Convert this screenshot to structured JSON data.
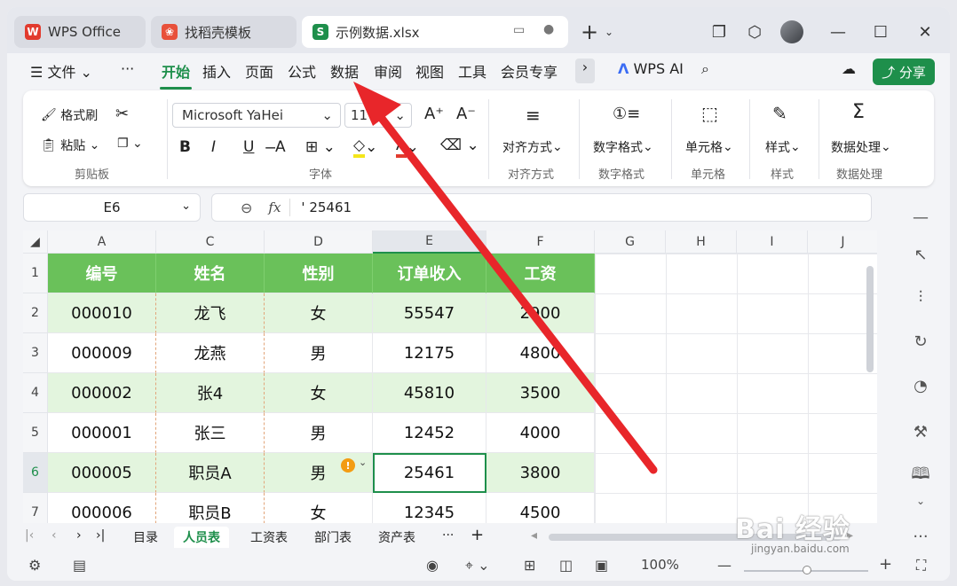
{
  "titlebar": {
    "tabs": [
      {
        "label": "WPS Office",
        "icon": "wps-logo-icon"
      },
      {
        "label": "找稻壳模板",
        "icon": "daoke-logo-icon"
      },
      {
        "label": "示例数据.xlsx",
        "icon": "sheet-logo-icon"
      }
    ],
    "new_tab": "+",
    "colors": {
      "accent": "#1e8f4b",
      "wps_red": "#e23b2e"
    }
  },
  "menubar": {
    "file_label": "文件",
    "items": [
      "开始",
      "插入",
      "页面",
      "公式",
      "数据",
      "审阅",
      "视图",
      "工具",
      "会员专享"
    ],
    "active": "开始",
    "wps_ai": "WPS AI",
    "share": "分享"
  },
  "ribbon": {
    "format_painter": "格式刷",
    "paste": "粘贴",
    "clipboard_group": "剪贴板",
    "font_name": "Microsoft YaHei",
    "font_size": "11",
    "font_group": "字体",
    "align_btn": "对齐方式",
    "align_group": "对齐方式",
    "number_btn": "数字格式",
    "number_group": "数字格式",
    "cell_btn": "单元格",
    "cell_group": "单元格",
    "style_btn": "样式",
    "style_group": "样式",
    "data_btn": "数据处理",
    "data_group": "数据处理"
  },
  "formula": {
    "name_box": "E6",
    "fx": "fx",
    "value": "' 25461"
  },
  "grid": {
    "columns": [
      "A",
      "C",
      "D",
      "E",
      "F",
      "G",
      "H",
      "I",
      "J"
    ],
    "rows": [
      "1",
      "2",
      "3",
      "4",
      "5",
      "6",
      "7"
    ],
    "header": [
      "编号",
      "姓名",
      "性别",
      "订单收入",
      "工资"
    ],
    "data": [
      [
        "000010",
        "龙飞",
        "女",
        "55547",
        "2900"
      ],
      [
        "000009",
        "龙燕",
        "男",
        "12175",
        "4800"
      ],
      [
        "000002",
        "张4",
        "女",
        "45810",
        "3500"
      ],
      [
        "000001",
        "张三",
        "男",
        "12452",
        "4000"
      ],
      [
        "000005",
        "职员A",
        "男",
        "25461",
        "3800"
      ],
      [
        "000006",
        "职员B",
        "女",
        "12345",
        "4500"
      ]
    ],
    "selected_cell": "E6"
  },
  "sheets": {
    "tabs": [
      "目录",
      "人员表",
      "工资表",
      "部门表",
      "资产表"
    ],
    "active": "人员表",
    "more": "···",
    "add": "+"
  },
  "status": {
    "zoom": "100%"
  },
  "watermark": {
    "main": "Bai 经验",
    "sub": "jingyan.baidu.com"
  }
}
